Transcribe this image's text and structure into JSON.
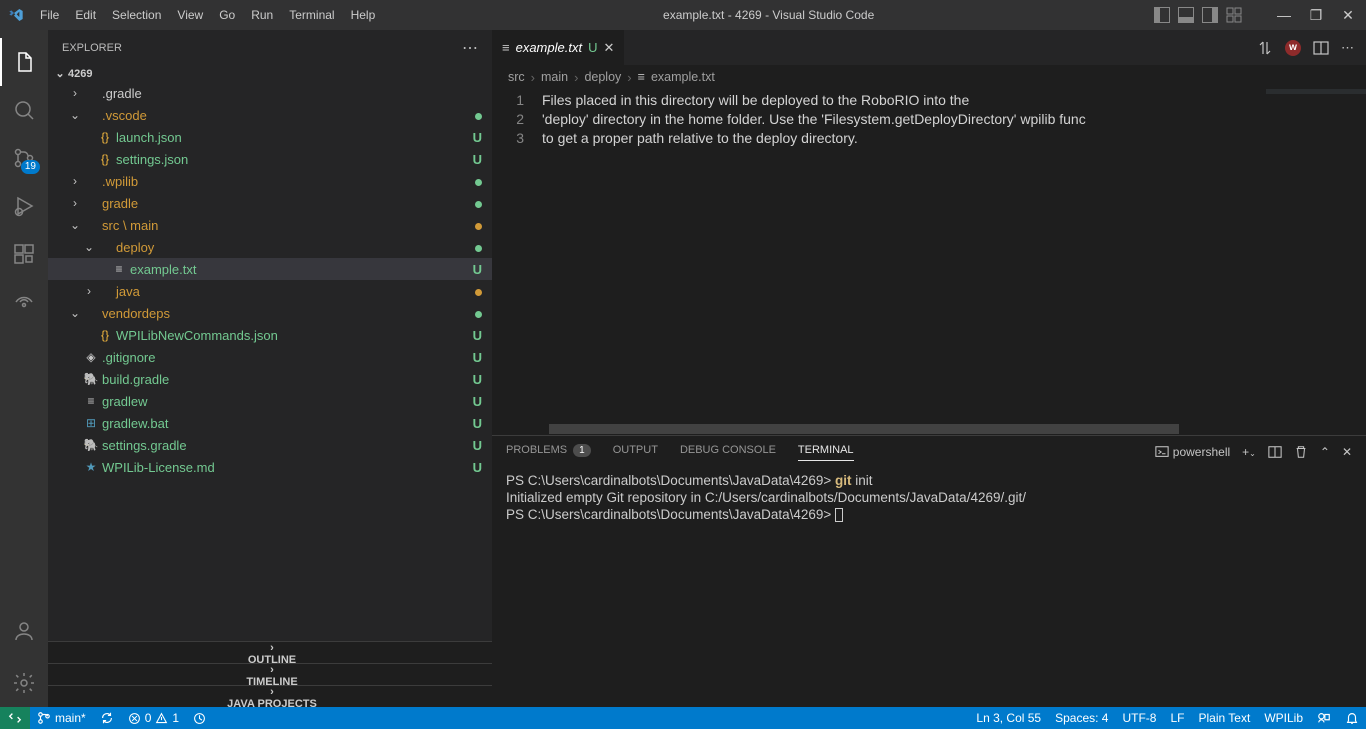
{
  "titlebar": {
    "menu": [
      "File",
      "Edit",
      "Selection",
      "View",
      "Go",
      "Run",
      "Terminal",
      "Help"
    ],
    "title": "example.txt - 4269 - Visual Studio Code"
  },
  "activitybar": {
    "scm_badge": "19"
  },
  "sidebar": {
    "title": "EXPLORER",
    "project": "4269",
    "panels": [
      "OUTLINE",
      "TIMELINE",
      "JAVA PROJECTS"
    ]
  },
  "tree": [
    {
      "indent": 1,
      "chev": "›",
      "icnClass": "ic-file",
      "icn": "",
      "name": ".gradle",
      "color": "col-default",
      "decor": ""
    },
    {
      "indent": 1,
      "chev": "⌄",
      "icnClass": "ic-file",
      "icn": "",
      "name": ".vscode",
      "color": "col-modified",
      "decor": "green-dot"
    },
    {
      "indent": 2,
      "chev": "",
      "icnClass": "ic-json",
      "icn": "{}",
      "name": "launch.json",
      "color": "col-untracked",
      "decor": "git-U"
    },
    {
      "indent": 2,
      "chev": "",
      "icnClass": "ic-json",
      "icn": "{}",
      "name": "settings.json",
      "color": "col-untracked",
      "decor": "git-U"
    },
    {
      "indent": 1,
      "chev": "›",
      "icnClass": "ic-file",
      "icn": "",
      "name": ".wpilib",
      "color": "col-modified",
      "decor": "green-dot"
    },
    {
      "indent": 1,
      "chev": "›",
      "icnClass": "ic-file",
      "icn": "",
      "name": "gradle",
      "color": "col-modified",
      "decor": "green-dot"
    },
    {
      "indent": 1,
      "chev": "⌄",
      "icnClass": "ic-file",
      "icn": "",
      "name": "src \\ main",
      "color": "col-modified",
      "decor": "orange-dot"
    },
    {
      "indent": 2,
      "chev": "⌄",
      "icnClass": "ic-file",
      "icn": "",
      "name": "deploy",
      "color": "col-modified",
      "decor": "green-dot"
    },
    {
      "indent": 3,
      "chev": "",
      "icnClass": "ic-file",
      "icn": "≡",
      "name": "example.txt",
      "color": "col-untracked",
      "decor": "git-U",
      "selected": true
    },
    {
      "indent": 2,
      "chev": "›",
      "icnClass": "ic-file",
      "icn": "",
      "name": "java",
      "color": "col-modified",
      "decor": "orange-dot"
    },
    {
      "indent": 1,
      "chev": "⌄",
      "icnClass": "ic-file",
      "icn": "",
      "name": "vendordeps",
      "color": "col-modified",
      "decor": "green-dot"
    },
    {
      "indent": 2,
      "chev": "",
      "icnClass": "ic-json",
      "icn": "{}",
      "name": "WPILibNewCommands.json",
      "color": "col-untracked",
      "decor": "git-U"
    },
    {
      "indent": 1,
      "chev": "",
      "icnClass": "ic-file",
      "icn": "◈",
      "name": ".gitignore",
      "color": "col-untracked",
      "decor": "git-U"
    },
    {
      "indent": 1,
      "chev": "",
      "icnClass": "ic-elephant",
      "icn": "🐘",
      "name": "build.gradle",
      "color": "col-untracked",
      "decor": "git-U"
    },
    {
      "indent": 1,
      "chev": "",
      "icnClass": "ic-file",
      "icn": "≡",
      "name": "gradlew",
      "color": "col-untracked",
      "decor": "git-U"
    },
    {
      "indent": 1,
      "chev": "",
      "icnClass": "ic-windows",
      "icn": "⊞",
      "name": "gradlew.bat",
      "color": "col-untracked",
      "decor": "git-U"
    },
    {
      "indent": 1,
      "chev": "",
      "icnClass": "ic-elephant",
      "icn": "🐘",
      "name": "settings.gradle",
      "color": "col-untracked",
      "decor": "git-U"
    },
    {
      "indent": 1,
      "chev": "",
      "icnClass": "ic-md",
      "icn": "★",
      "name": "WPILib-License.md",
      "color": "col-untracked",
      "decor": "git-U"
    }
  ],
  "tab": {
    "filename": "example.txt",
    "modifier": "U"
  },
  "breadcrumbs": [
    "src",
    "main",
    "deploy",
    "example.txt"
  ],
  "editor": {
    "lines": [
      "Files placed in this directory will be deployed to the RoboRIO into the",
      "'deploy' directory in the home folder. Use the 'Filesystem.getDeployDirectory' wpilib func",
      "to get a proper path relative to the deploy directory."
    ]
  },
  "panel": {
    "tabs": {
      "problems": "PROBLEMS",
      "problems_count": "1",
      "output": "OUTPUT",
      "debug": "DEBUG CONSOLE",
      "terminal": "TERMINAL"
    },
    "terminal_type": "powershell",
    "terminal_lines": [
      {
        "prefix": "PS C:\\Users\\cardinalbots\\Documents\\JavaData\\4269> ",
        "cmd": "git",
        "args": " init"
      },
      {
        "text": "Initialized empty Git repository in C:/Users/cardinalbots/Documents/JavaData/4269/.git/"
      },
      {
        "prefix": "PS C:\\Users\\cardinalbots\\Documents\\JavaData\\4269> ",
        "cursor": true
      }
    ]
  },
  "statusbar": {
    "branch": "main*",
    "sync": "⟳",
    "errors": "0",
    "warnings": "1",
    "port": "⚡",
    "ln_col": "Ln 3, Col 55",
    "spaces": "Spaces: 4",
    "encoding": "UTF-8",
    "eol": "LF",
    "lang": "Plain Text",
    "wpilib": "WPILib"
  }
}
